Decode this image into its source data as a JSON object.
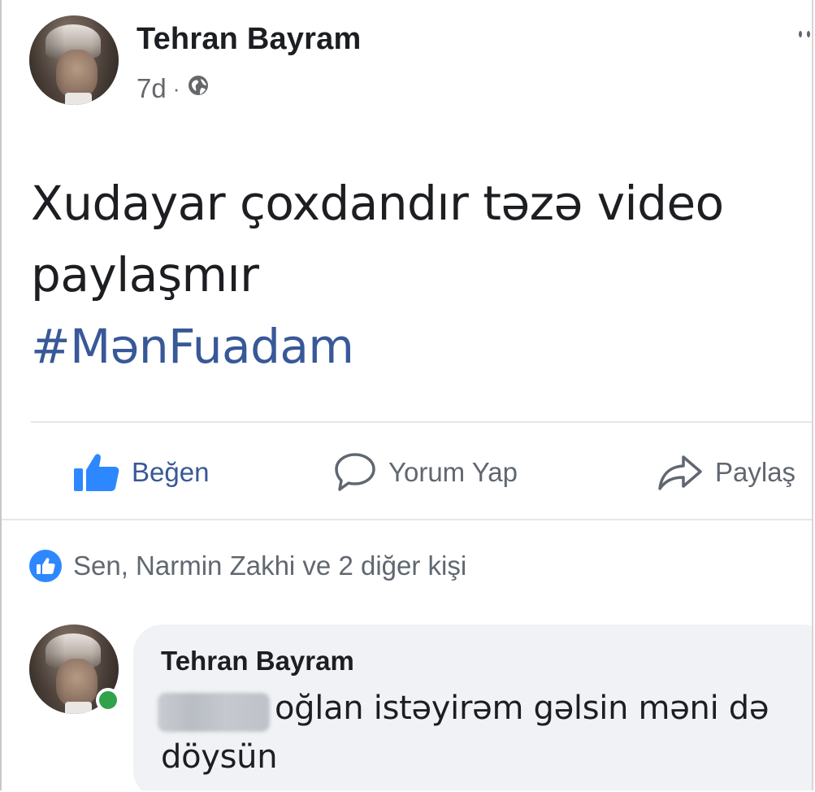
{
  "post": {
    "author": "Tehran Bayram",
    "time": "7d",
    "separator": "·",
    "privacy_icon": "globe-icon",
    "text": "Xudayar çoxdandır təzə video paylaşmır",
    "hashtag": "#MənFuadam"
  },
  "actions": {
    "like_label": "Beğen",
    "comment_label": "Yorum Yap",
    "share_label": "Paylaş"
  },
  "reactions": {
    "summary": "Sen, Narmin Zakhi ve 2 diğer kişi"
  },
  "comment": {
    "author": "Tehran Bayram",
    "line1": "oğlan istəyirəm gəlsin məni də",
    "line2": "döysün"
  },
  "colors": {
    "accent": "#385898",
    "like_blue": "#2d88ff",
    "online_green": "#31a24c",
    "muted_text": "#606770",
    "bubble_bg": "#f0f2f5"
  }
}
